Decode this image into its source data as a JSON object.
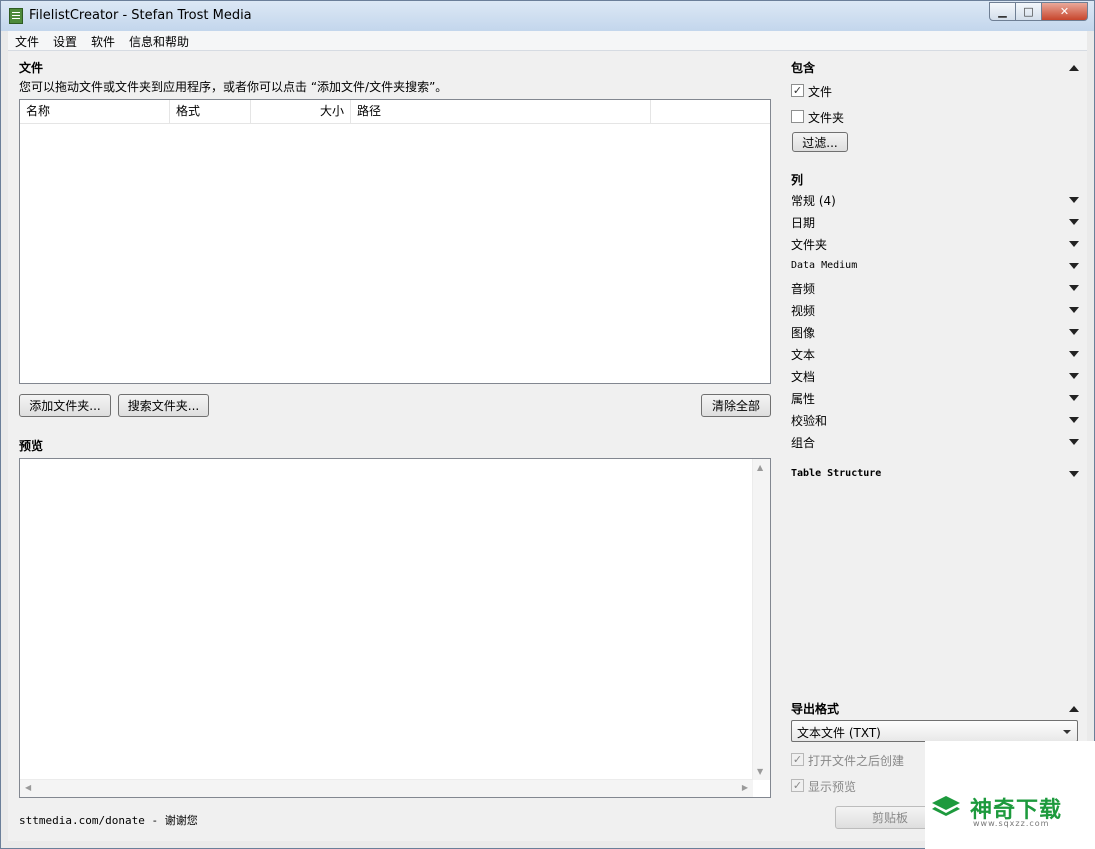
{
  "window": {
    "title": "FilelistCreator - Stefan Trost Media",
    "controls": {
      "min": "▁",
      "max": "□",
      "close": "✕"
    }
  },
  "menu": [
    "文件",
    "设置",
    "软件",
    "信息和帮助"
  ],
  "files": {
    "heading": "文件",
    "hint": "您可以拖动文件或文件夹到应用程序，或者你可以点击 “添加文件/文件夹搜索”。",
    "columns": [
      "名称",
      "格式",
      "大小",
      "路径"
    ],
    "buttons": {
      "add": "添加文件夹...",
      "search": "搜索文件夹...",
      "clear": "清除全部"
    }
  },
  "preview": {
    "heading": "预览"
  },
  "footer": {
    "donate": "sttmedia.com/donate - 谢谢您"
  },
  "include": {
    "heading": "包含",
    "items": [
      {
        "label": "文件",
        "checked": true
      },
      {
        "label": "文件夹",
        "checked": false
      }
    ],
    "filter_button": "过滤..."
  },
  "columns_panel": {
    "heading": "列",
    "groups": [
      "常规 (4)",
      "日期",
      "文件夹",
      "Data Medium",
      "音频",
      "视频",
      "图像",
      "文本",
      "文档",
      "属性",
      "校验和",
      "组合"
    ],
    "table_structure": "Table Structure"
  },
  "export": {
    "heading": "导出格式",
    "format": "文本文件 (TXT)",
    "options": [
      {
        "label": "打开文件之后创建",
        "checked": true
      },
      {
        "label": "显示预览",
        "checked": true
      }
    ],
    "clipboard_button": "剪贴板"
  },
  "watermark": {
    "brand": "神奇下载",
    "url": "www.sqxzz.com"
  }
}
